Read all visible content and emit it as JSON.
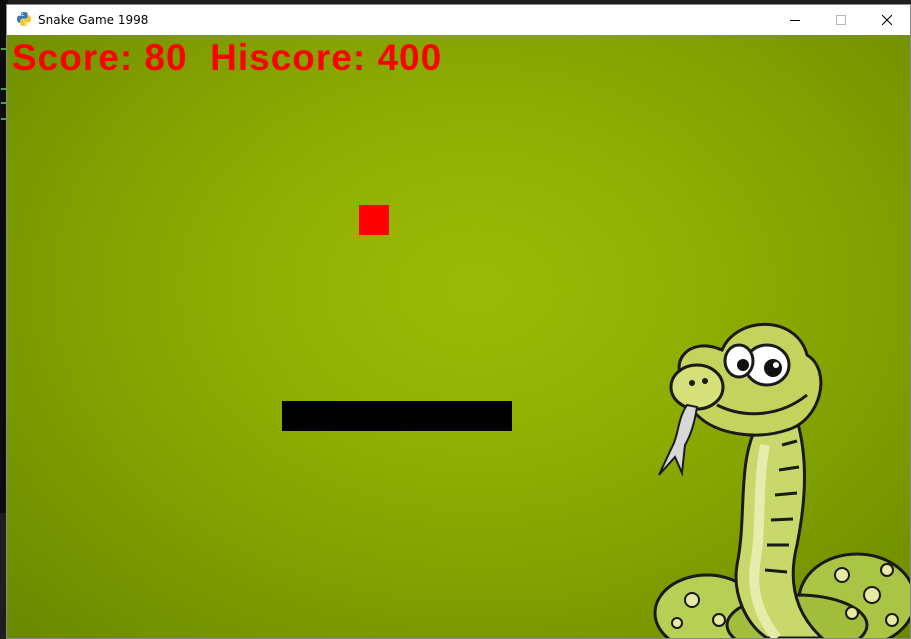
{
  "window": {
    "title": "Snake Game 1998",
    "app_icon": "python-icon",
    "controls": [
      "minimize-icon",
      "maximize-icon",
      "close-icon"
    ]
  },
  "hud": {
    "text": "Score: 80  Hiscore: 400",
    "score": 80,
    "hiscore": 400,
    "color": "#ff0000"
  },
  "game": {
    "background_color": "#8fae03",
    "food_color": "#ff0000",
    "snake_color": "#000000",
    "snake_length_segments": 8,
    "mascot": "cartoon-snake-illustration"
  }
}
